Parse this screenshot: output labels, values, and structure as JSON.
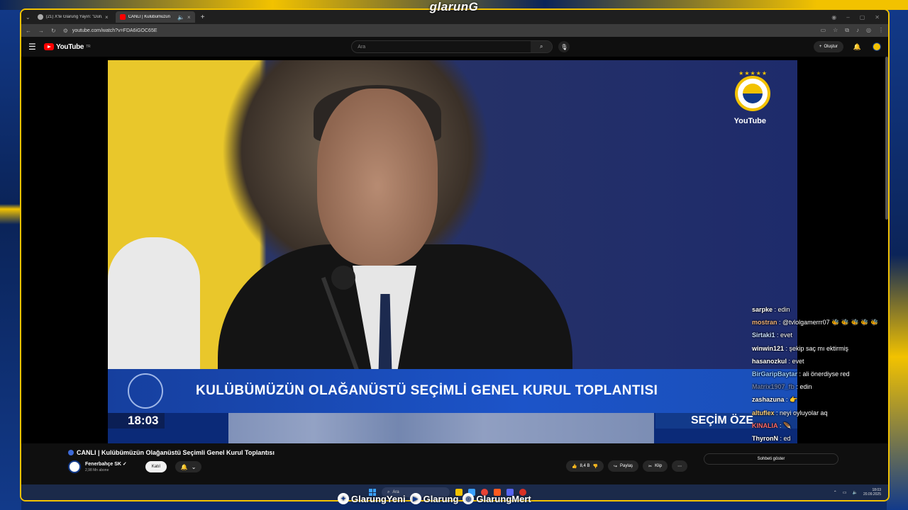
{
  "overlay": {
    "logo": "glarunG",
    "socials": [
      {
        "icon": "twitter-icon",
        "glyph": "✦",
        "label": "GlarungYeni"
      },
      {
        "icon": "youtube-icon",
        "glyph": "▶",
        "label": "Glarung"
      },
      {
        "icon": "instagram-icon",
        "glyph": "◎",
        "label": "GlarungMert"
      }
    ]
  },
  "browser": {
    "tabs": [
      {
        "title": "(21) X'te Glarung Yayın: \"Dün, İ",
        "active": false
      },
      {
        "title": "CANLI | Kulübümüzün",
        "active": true
      }
    ],
    "url": "youtube.com/watch?v=FDA6iGOC65E"
  },
  "youtube": {
    "logo_text": "YouTube",
    "region": "TR",
    "search_placeholder": "Ara",
    "create_label": "Oluştur"
  },
  "video": {
    "lower_third_title": "KULÜBÜMÜZÜN OLAĞANÜSTÜ SEÇİMLİ GENEL KURUL TOPLANTISI",
    "clock": "18:03",
    "secim_text": "SEÇİM ÖZE",
    "channel_bug": "YouTube",
    "title": "CANLI | Kulübümüzün Olağanüstü Seçimli Genel Kurul Toplantısı",
    "channel_name": "Fenerbahçe SK",
    "subscribers": "2,98 Mn abone",
    "join_label": "Katıl",
    "likes": "8,4 B",
    "share_label": "Paylaş",
    "clip_label": "Klip",
    "show_chat_label": "Sohbeti göster"
  },
  "chat": [
    {
      "user": "sarpke",
      "msg": "edin",
      "color": "#ffffff"
    },
    {
      "user": "mostran",
      "msg": "@tvlolgamerrr07 🐝 🐝 🐝 🐝 🐝",
      "color": "#f0b27a"
    },
    {
      "user": "Sirtaki1",
      "msg": "evet",
      "color": "#c9e0ff"
    },
    {
      "user": "winwin121",
      "msg": "şekip saç mı ektirmiş",
      "color": "#ffffff"
    },
    {
      "user": "hasanozkul",
      "msg": "evet",
      "color": "#ffffff"
    },
    {
      "user": "BirGaripBaytar",
      "msg": "ali önerdiyse red",
      "color": "#9fd0ff"
    },
    {
      "user": "Matrix1907_fb",
      "msg": "edin",
      "color": "#6b7fb0"
    },
    {
      "user": "zashazuna",
      "msg": "👉",
      "color": "#ffffff"
    },
    {
      "user": "altuflex",
      "msg": "neyi oyluyolar aq",
      "color": "#ffd27a"
    },
    {
      "user": "KINALIA",
      "msg": "🪶",
      "color": "#ff6b6b"
    },
    {
      "user": "ThyronN",
      "msg": "ed",
      "color": "#ffffff"
    }
  ],
  "taskbar": {
    "search_placeholder": "Ara",
    "time": "18:03",
    "date": "20.09.2025"
  }
}
